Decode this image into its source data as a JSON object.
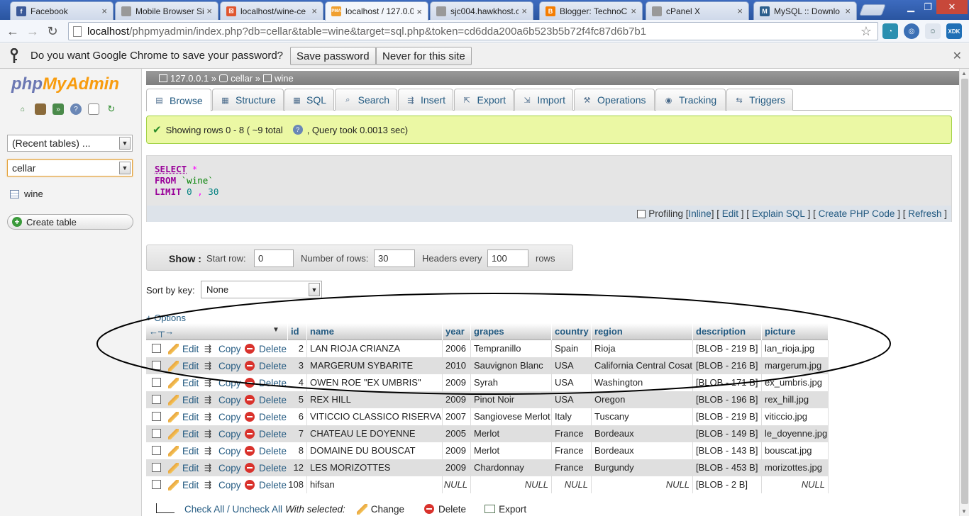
{
  "browser": {
    "tabs": [
      {
        "title": "Facebook",
        "icon": "facebook-icon",
        "color": "#3b5998",
        "glyph": "f"
      },
      {
        "title": "Mobile Browser Si",
        "icon": "page-icon",
        "color": "#999999",
        "glyph": ""
      },
      {
        "title": "localhost/wine-ce",
        "icon": "app-icon",
        "color": "#e0552d",
        "glyph": "⊠"
      },
      {
        "title": "localhost / 127.0.0",
        "icon": "pma-icon",
        "color": "#f0a030",
        "glyph": "PMA"
      },
      {
        "title": "sjc004.hawkhost.c",
        "icon": "page-icon",
        "color": "#999999",
        "glyph": ""
      },
      {
        "title": "Blogger: TechnoC",
        "icon": "blogger-icon",
        "color": "#f57d00",
        "glyph": "B"
      },
      {
        "title": "cPanel X",
        "icon": "page-icon",
        "color": "#999999",
        "glyph": ""
      },
      {
        "title": "MySQL :: Downlo",
        "icon": "mysql-icon",
        "color": "#2b5e8c",
        "glyph": "M"
      }
    ],
    "active_tab": 3,
    "url_host": "localhost",
    "url_rest": "/phpmyadmin/index.php?db=cellar&table=wine&target=sql.php&token=cd6dda200a6b523b5b72f4fc87d6b7b1",
    "extensions": [
      "wave-icon",
      "globe-icon",
      "avatar-icon",
      "xdk-icon"
    ],
    "xdk_label": "XDK"
  },
  "infobar": {
    "question": "Do you want Google Chrome to save your password?",
    "save_label": "Save password",
    "never_label": "Never for this site"
  },
  "nav": {
    "logo_php": "php",
    "logo_myadmin": "MyAdmin",
    "recent": "(Recent tables) ...",
    "database": "cellar",
    "table": "wine",
    "create_label": "Create table"
  },
  "breadcrumb": {
    "server": "127.0.0.1",
    "db": "cellar",
    "table": "wine",
    "sep": "»"
  },
  "tabs": [
    {
      "label": "Browse",
      "icon": "browse-icon"
    },
    {
      "label": "Structure",
      "icon": "structure-icon"
    },
    {
      "label": "SQL",
      "icon": "sql-icon"
    },
    {
      "label": "Search",
      "icon": "search-icon"
    },
    {
      "label": "Insert",
      "icon": "insert-icon"
    },
    {
      "label": "Export",
      "icon": "export-icon"
    },
    {
      "label": "Import",
      "icon": "import-icon"
    },
    {
      "label": "Operations",
      "icon": "wrench-icon"
    },
    {
      "label": "Tracking",
      "icon": "eye-icon"
    },
    {
      "label": "Triggers",
      "icon": "triggers-icon"
    }
  ],
  "message": {
    "showing": "Showing rows 0 - 8 ( ~9 total",
    "took": ", Query took 0.0013 sec)"
  },
  "sql": {
    "select": "SELECT",
    "star": "*",
    "from": "FROM",
    "table": "`wine`",
    "limit": "LIMIT",
    "offset": "0",
    "comma": ",",
    "count": "30"
  },
  "sql_links": {
    "profiling": "Profiling",
    "inline": "Inline",
    "edit": "Edit",
    "explain": "Explain SQL",
    "php": "Create PHP Code",
    "refresh": "Refresh"
  },
  "show": {
    "title": "Show :",
    "start_label": "Start row:",
    "start_value": "0",
    "rows_label": "Number of rows:",
    "rows_value": "30",
    "headers_label": "Headers every",
    "headers_value": "100",
    "rows_suffix": "rows"
  },
  "sort": {
    "label": "Sort by key:",
    "value": "None"
  },
  "options_label": "+ Options",
  "columns": [
    "id",
    "name",
    "year",
    "grapes",
    "country",
    "region",
    "description",
    "picture"
  ],
  "row_actions": {
    "edit": "Edit",
    "copy": "Copy",
    "delete": "Delete"
  },
  "rows": [
    {
      "id": "2",
      "name": "LAN RIOJA CRIANZA",
      "year": "2006",
      "grapes": "Tempranillo",
      "country": "Spain",
      "region": "Rioja",
      "description": "[BLOB - 219 B]",
      "picture": "lan_rioja.jpg"
    },
    {
      "id": "3",
      "name": "MARGERUM SYBARITE",
      "year": "2010",
      "grapes": "Sauvignon Blanc",
      "country": "USA",
      "region": "California Central Cosat",
      "description": "[BLOB - 216 B]",
      "picture": "margerum.jpg"
    },
    {
      "id": "4",
      "name": "OWEN ROE \"EX UMBRIS\"",
      "year": "2009",
      "grapes": "Syrah",
      "country": "USA",
      "region": "Washington",
      "description": "[BLOB - 171 B]",
      "picture": "ex_umbris.jpg"
    },
    {
      "id": "5",
      "name": "REX HILL",
      "year": "2009",
      "grapes": "Pinot Noir",
      "country": "USA",
      "region": "Oregon",
      "description": "[BLOB - 196 B]",
      "picture": "rex_hill.jpg"
    },
    {
      "id": "6",
      "name": "VITICCIO CLASSICO RISERVA",
      "year": "2007",
      "grapes": "Sangiovese Merlot",
      "country": "Italy",
      "region": "Tuscany",
      "description": "[BLOB - 219 B]",
      "picture": "viticcio.jpg"
    },
    {
      "id": "7",
      "name": "CHATEAU LE DOYENNE",
      "year": "2005",
      "grapes": "Merlot",
      "country": "France",
      "region": "Bordeaux",
      "description": "[BLOB - 149 B]",
      "picture": "le_doyenne.jpg"
    },
    {
      "id": "8",
      "name": "DOMAINE DU BOUSCAT",
      "year": "2009",
      "grapes": "Merlot",
      "country": "France",
      "region": "Bordeaux",
      "description": "[BLOB - 143 B]",
      "picture": "bouscat.jpg"
    },
    {
      "id": "12",
      "name": "LES MORIZOTTES",
      "year": "2009",
      "grapes": "Chardonnay",
      "country": "France",
      "region": "Burgundy",
      "description": "[BLOB - 453 B]",
      "picture": "morizottes.jpg"
    },
    {
      "id": "108",
      "name": "hifsan",
      "year": "NULL",
      "grapes": "NULL",
      "country": "NULL",
      "region": "NULL",
      "description": "[BLOB - 2 B]",
      "picture": "NULL"
    }
  ],
  "footer": {
    "check_all": "Check All / Uncheck All",
    "with_selected": "With selected:",
    "change": "Change",
    "delete": "Delete",
    "export": "Export"
  }
}
